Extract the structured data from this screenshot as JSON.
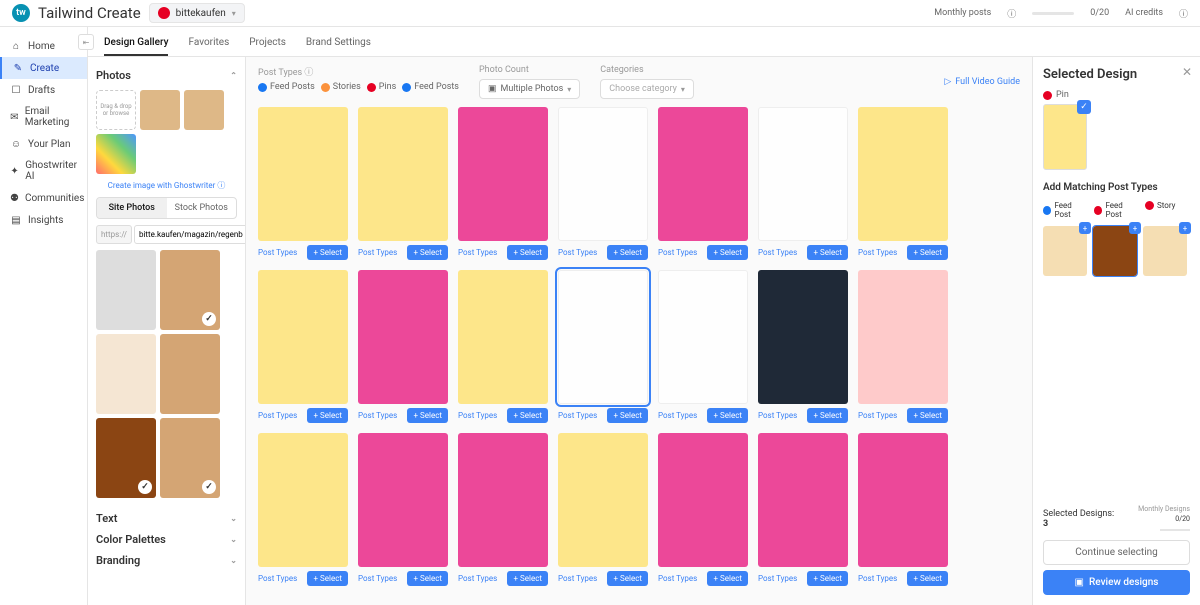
{
  "app": {
    "title": "Tailwind Create",
    "logo_text": "tw"
  },
  "site": {
    "name": "bittekaufen"
  },
  "header_stats": {
    "monthly_posts_label": "Monthly posts",
    "monthly_posts_value": "0/20",
    "ai_credits_label": "AI credits"
  },
  "sidebar": {
    "items": [
      {
        "label": "Home",
        "icon": "home-icon"
      },
      {
        "label": "Create",
        "icon": "pencil-icon"
      },
      {
        "label": "Drafts",
        "icon": "inbox-icon"
      },
      {
        "label": "Email Marketing",
        "icon": "mail-icon"
      },
      {
        "label": "Your Plan",
        "icon": "user-icon"
      },
      {
        "label": "Ghostwriter AI",
        "icon": "sparkle-icon"
      },
      {
        "label": "Communities",
        "icon": "people-icon"
      },
      {
        "label": "Insights",
        "icon": "chart-icon"
      }
    ]
  },
  "tabs": [
    "Design Gallery",
    "Favorites",
    "Projects",
    "Brand Settings"
  ],
  "config": {
    "photos_header": "Photos",
    "upload_hint": "Drag & drop or browse",
    "ghostwriter_link": "Create image with Ghostwriter",
    "photo_tabs": [
      "Site Photos",
      "Stock Photos"
    ],
    "url_prefix": "https://",
    "url_value": "bitte.kaufen/magazin/regenb",
    "sections": [
      "Text",
      "Color Palettes",
      "Branding"
    ]
  },
  "filters": {
    "post_types_label": "Post Types",
    "chips": [
      {
        "label": "Feed Posts",
        "color": "dot-blue"
      },
      {
        "label": "Stories",
        "color": "dot-orange"
      },
      {
        "label": "Pins",
        "color": "dot-red"
      },
      {
        "label": "Feed Posts",
        "color": "dot-blue"
      }
    ],
    "photo_count_label": "Photo Count",
    "photo_count_value": "Multiple Photos",
    "categories_label": "Categories",
    "categories_placeholder": "Choose category",
    "video_guide": "Full Video Guide"
  },
  "gallery": {
    "post_types_link": "Post Types",
    "select_label": "Select",
    "cards": [
      {
        "cls": "yellow"
      },
      {
        "cls": "yellow"
      },
      {
        "cls": "pink"
      },
      {
        "cls": "white"
      },
      {
        "cls": "pink"
      },
      {
        "cls": "white"
      },
      {
        "cls": "yellow"
      },
      {
        "cls": "yellow"
      },
      {
        "cls": "pink"
      },
      {
        "cls": "yellow"
      },
      {
        "cls": "white",
        "sel": true
      },
      {
        "cls": "white"
      },
      {
        "cls": "dark"
      },
      {
        "cls": "peach"
      },
      {
        "cls": "yellow"
      },
      {
        "cls": "pink"
      },
      {
        "cls": "pink"
      },
      {
        "cls": "yellow"
      },
      {
        "cls": "pink"
      },
      {
        "cls": "pink"
      },
      {
        "cls": "pink"
      }
    ]
  },
  "right": {
    "title": "Selected Design",
    "pin_label": "Pin",
    "matching_title": "Add Matching Post Types",
    "matches": [
      {
        "label": "Feed Post",
        "color": "dot-blue"
      },
      {
        "label": "Feed Post",
        "color": "dot-red"
      },
      {
        "label": "Story",
        "color": "dot-red"
      }
    ],
    "footer": {
      "selected_label": "Selected Designs:",
      "selected_count": "3",
      "monthly_designs_label": "Monthly Designs",
      "monthly_designs_value": "0/20",
      "continue_label": "Continue selecting",
      "review_label": "Review designs"
    }
  }
}
